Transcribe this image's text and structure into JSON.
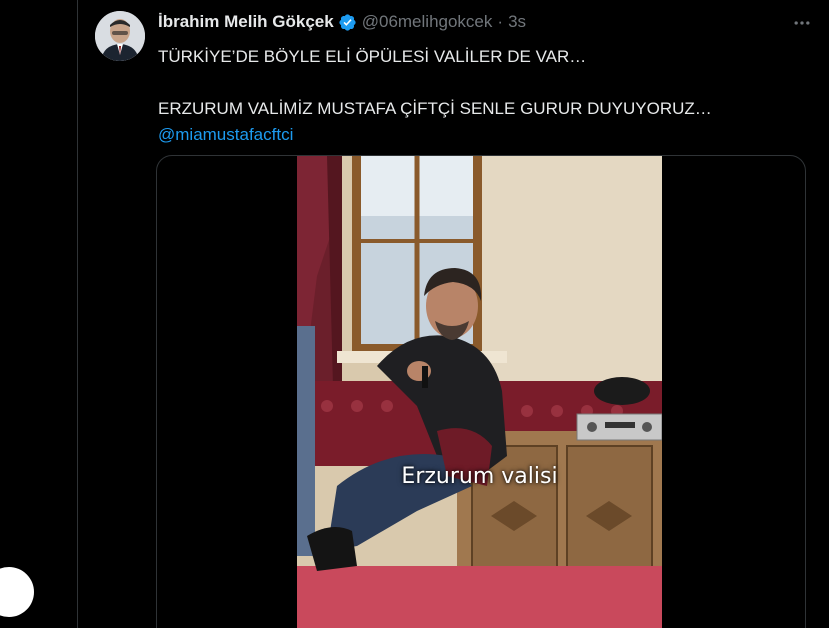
{
  "tweet": {
    "display_name": "İbrahim Melih Gökçek",
    "handle": "@06melihgokcek",
    "separator": "·",
    "timestamp": "3s",
    "text_line_1": "TÜRKİYE’DE BÖYLE ELİ ÖPÜLESİ VALİLER DE VAR…",
    "text_line_2": "ERZURUM VALİMİZ MUSTAFA ÇİFTÇİ SENLE GURUR DUYUYORUZ…",
    "mention": "@miamustafacftci",
    "video_caption": "Erzurum valisi"
  },
  "icons": {
    "verified": "verified-badge-icon",
    "more": "more-options-icon"
  },
  "colors": {
    "background": "#000000",
    "text": "#e7e9ea",
    "muted": "#71767b",
    "accent": "#1d9bf0",
    "border": "#2f3336"
  }
}
